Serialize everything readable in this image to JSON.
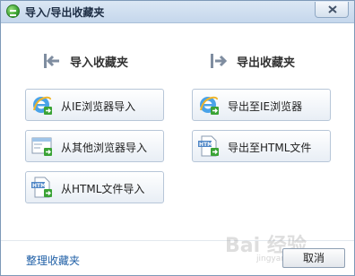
{
  "window": {
    "title": "导入/导出收藏夹"
  },
  "import": {
    "heading": "导入收藏夹",
    "buttons": [
      {
        "label": "从IE浏览器导入",
        "icon": "ie-icon"
      },
      {
        "label": "从其他浏览器导入",
        "icon": "browser-window-icon"
      },
      {
        "label": "从HTML文件导入",
        "icon": "html-file-icon"
      }
    ]
  },
  "export": {
    "heading": "导出收藏夹",
    "buttons": [
      {
        "label": "导出至IE浏览器",
        "icon": "ie-icon"
      },
      {
        "label": "导出至HTML文件",
        "icon": "html-file-icon"
      }
    ]
  },
  "footer": {
    "manage_link": "整理收藏夹",
    "cancel_label": "取消"
  },
  "watermark": {
    "text": "Bai 经验",
    "subtext": "jingyan.baidu.com"
  },
  "colors": {
    "link": "#1f5fa6",
    "titlebar": "#c5d7ec",
    "accent_green": "#3aa335"
  }
}
